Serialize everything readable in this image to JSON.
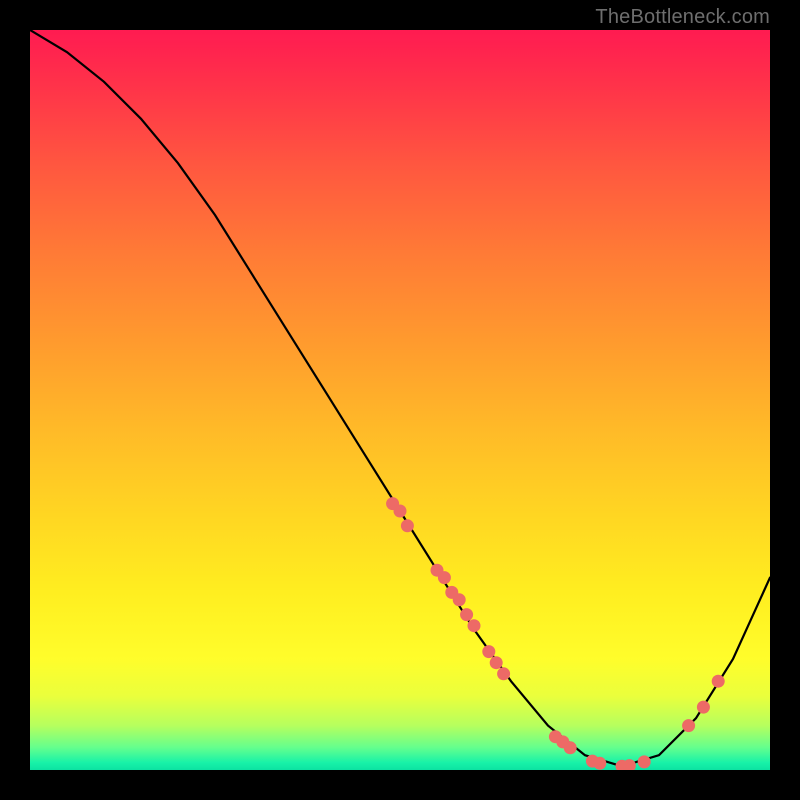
{
  "attribution": "TheBottleneck.com",
  "colors": {
    "curve_stroke": "#000000",
    "dot_fill": "#ed6a66",
    "page_bg": "#000000"
  },
  "chart_data": {
    "type": "line",
    "title": "",
    "xlabel": "",
    "ylabel": "",
    "xlim": [
      0,
      100
    ],
    "ylim": [
      0,
      100
    ],
    "series": [
      {
        "name": "bottleneck-curve",
        "x": [
          0,
          5,
          10,
          15,
          20,
          25,
          30,
          35,
          40,
          45,
          50,
          55,
          60,
          65,
          70,
          75,
          80,
          85,
          90,
          95,
          100
        ],
        "values": [
          100,
          97,
          93,
          88,
          82,
          75,
          67,
          59,
          51,
          43,
          35,
          27,
          19,
          12,
          6,
          2,
          0.5,
          2,
          7,
          15,
          26
        ]
      }
    ],
    "highlight_points": {
      "name": "cluster-dots",
      "points": [
        {
          "x": 49,
          "y": 36
        },
        {
          "x": 50,
          "y": 35
        },
        {
          "x": 51,
          "y": 33
        },
        {
          "x": 55,
          "y": 27
        },
        {
          "x": 56,
          "y": 26
        },
        {
          "x": 57,
          "y": 24
        },
        {
          "x": 58,
          "y": 23
        },
        {
          "x": 59,
          "y": 21
        },
        {
          "x": 60,
          "y": 19.5
        },
        {
          "x": 62,
          "y": 16
        },
        {
          "x": 63,
          "y": 14.5
        },
        {
          "x": 64,
          "y": 13
        },
        {
          "x": 71,
          "y": 4.5
        },
        {
          "x": 72,
          "y": 3.8
        },
        {
          "x": 73,
          "y": 3
        },
        {
          "x": 76,
          "y": 1.2
        },
        {
          "x": 77,
          "y": 0.9
        },
        {
          "x": 80,
          "y": 0.5
        },
        {
          "x": 81,
          "y": 0.6
        },
        {
          "x": 83,
          "y": 1.1
        },
        {
          "x": 89,
          "y": 6
        },
        {
          "x": 91,
          "y": 8.5
        },
        {
          "x": 93,
          "y": 12
        }
      ]
    }
  }
}
